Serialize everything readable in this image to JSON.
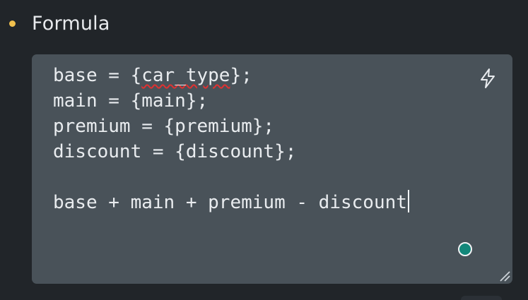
{
  "field": {
    "label": "Formula",
    "required_dot_color": "#f0c04d"
  },
  "editor": {
    "lines": [
      {
        "before": "base = {",
        "squiggle": "car_type",
        "after": "};"
      },
      {
        "text": "main = {main};"
      },
      {
        "text": "premium = {premium};"
      },
      {
        "text": "discount = {discount};"
      },
      {
        "text": ""
      },
      {
        "text": "base + main + premium - discount"
      }
    ],
    "icons": {
      "assist": "lightning-bolt-icon",
      "status": "status-indicator-dot",
      "resize": "resize-handle-icon"
    }
  },
  "colors": {
    "background": "#212529",
    "editor_background": "#495259",
    "text": "#e9ecef",
    "error_squiggle": "#e03131",
    "status": "#13877a"
  }
}
